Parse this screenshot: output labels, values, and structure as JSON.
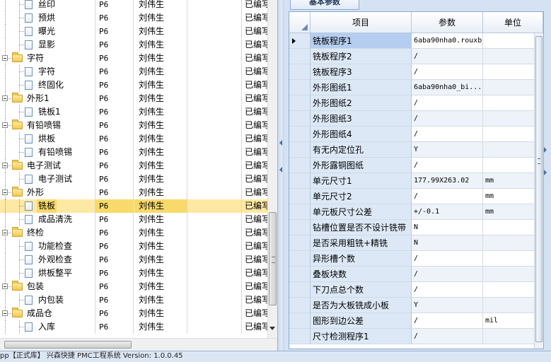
{
  "tree": {
    "rows": [
      {
        "level": 1,
        "kind": "file",
        "name": "丝印",
        "code": "P6",
        "user": "刘伟生",
        "status": "已编写"
      },
      {
        "level": 1,
        "kind": "file",
        "name": "预烘",
        "code": "P6",
        "user": "刘伟生",
        "status": "已编写"
      },
      {
        "level": 1,
        "kind": "file",
        "name": "曝光",
        "code": "P6",
        "user": "刘伟生",
        "status": "已编写"
      },
      {
        "level": 1,
        "kind": "file",
        "name": "显影",
        "code": "P6",
        "user": "刘伟生",
        "status": "已编写"
      },
      {
        "level": 0,
        "kind": "folder",
        "name": "字符",
        "code": "P6",
        "user": "刘伟生",
        "status": "已编写"
      },
      {
        "level": 1,
        "kind": "file",
        "name": "字符",
        "code": "P6",
        "user": "刘伟生",
        "status": "已编写"
      },
      {
        "level": 1,
        "kind": "file",
        "name": "终固化",
        "code": "P6",
        "user": "刘伟生",
        "status": "已编写"
      },
      {
        "level": 0,
        "kind": "folder",
        "name": "外形1",
        "code": "P6",
        "user": "刘伟生",
        "status": "已编写"
      },
      {
        "level": 1,
        "kind": "file",
        "name": "铣板1",
        "code": "P6",
        "user": "刘伟生",
        "status": "已编写"
      },
      {
        "level": 0,
        "kind": "folder",
        "name": "有铅喷锡",
        "code": "P6",
        "user": "刘伟生",
        "status": "已编写"
      },
      {
        "level": 1,
        "kind": "file",
        "name": "烘板",
        "code": "P6",
        "user": "刘伟生",
        "status": "已编写"
      },
      {
        "level": 1,
        "kind": "file",
        "name": "有铅喷锡",
        "code": "P6",
        "user": "刘伟生",
        "status": "已编写"
      },
      {
        "level": 0,
        "kind": "folder",
        "name": "电子测试",
        "code": "P6",
        "user": "刘伟生",
        "status": "已编写"
      },
      {
        "level": 1,
        "kind": "file",
        "name": "电子测试",
        "code": "P6",
        "user": "刘伟生",
        "status": "已编写"
      },
      {
        "level": 0,
        "kind": "folder",
        "name": "外形",
        "code": "P6",
        "user": "刘伟生",
        "status": "已编写"
      },
      {
        "level": 1,
        "kind": "file",
        "name": "铣板",
        "code": "P6",
        "user": "刘伟生",
        "status": "已编写",
        "selected": true
      },
      {
        "level": 1,
        "kind": "file",
        "name": "成品清洗",
        "code": "P6",
        "user": "刘伟生",
        "status": "已编写"
      },
      {
        "level": 0,
        "kind": "folder",
        "name": "终检",
        "code": "P6",
        "user": "刘伟生",
        "status": "已编写"
      },
      {
        "level": 1,
        "kind": "file",
        "name": "功能检查",
        "code": "P6",
        "user": "刘伟生",
        "status": "已编写"
      },
      {
        "level": 1,
        "kind": "file",
        "name": "外观检查",
        "code": "P6",
        "user": "刘伟生",
        "status": "已编写"
      },
      {
        "level": 1,
        "kind": "file",
        "name": "烘板整平",
        "code": "P6",
        "user": "刘伟生",
        "status": "已编写"
      },
      {
        "level": 0,
        "kind": "folder",
        "name": "包装",
        "code": "P6",
        "user": "刘伟生",
        "status": "已编写"
      },
      {
        "level": 1,
        "kind": "file",
        "name": "内包装",
        "code": "P6",
        "user": "刘伟生",
        "status": "已编写"
      },
      {
        "level": 0,
        "kind": "folder",
        "name": "成品仓",
        "code": "P6",
        "user": "刘伟生",
        "status": "已编写"
      },
      {
        "level": 1,
        "kind": "file",
        "name": "入库",
        "code": "P6",
        "user": "刘伟生",
        "status": "已编写"
      }
    ]
  },
  "params": {
    "tab_label": "基本参数",
    "headers": {
      "item": "项目",
      "value": "参数",
      "unit": "单位"
    },
    "rows": [
      {
        "item": "铣板程序1",
        "value": "6aba90nha0.rouxb",
        "unit": "",
        "current": true
      },
      {
        "item": "铣板程序2",
        "value": "/",
        "unit": ""
      },
      {
        "item": "铣板程序3",
        "value": "/",
        "unit": ""
      },
      {
        "item": "外形图纸1",
        "value": "6aba90nha0_bi...",
        "unit": ""
      },
      {
        "item": "外形图纸2",
        "value": "/",
        "unit": ""
      },
      {
        "item": "外形图纸3",
        "value": "/",
        "unit": ""
      },
      {
        "item": "外形图纸4",
        "value": "/",
        "unit": ""
      },
      {
        "item": "有无内定位孔",
        "value": "Y",
        "unit": ""
      },
      {
        "item": "外形露铜图纸",
        "value": "/",
        "unit": ""
      },
      {
        "item": "单元尺寸1",
        "value": "177.99X263.02",
        "unit": "mm"
      },
      {
        "item": "单元尺寸2",
        "value": "/",
        "unit": "mm"
      },
      {
        "item": "单元板尺寸公差",
        "value": "+/-0.1",
        "unit": "mm"
      },
      {
        "item": "钻槽位置是否不设计铣带",
        "value": "N",
        "unit": ""
      },
      {
        "item": "是否采用粗铣+精铣",
        "value": "N",
        "unit": ""
      },
      {
        "item": "异形槽个数",
        "value": "/",
        "unit": ""
      },
      {
        "item": "叠板块数",
        "value": "/",
        "unit": ""
      },
      {
        "item": "下刀点总个数",
        "value": "/",
        "unit": ""
      },
      {
        "item": "是否为大板铣成小板",
        "value": "Y",
        "unit": ""
      },
      {
        "item": "图形到边公差",
        "value": "/",
        "unit": "mil"
      },
      {
        "item": "尺寸检测程序1",
        "value": "/",
        "unit": ""
      }
    ]
  },
  "status_bar": {
    "text": "pp【正式库】                    兴森快捷 PMC工程系统 Version: 1.0.0.45"
  }
}
